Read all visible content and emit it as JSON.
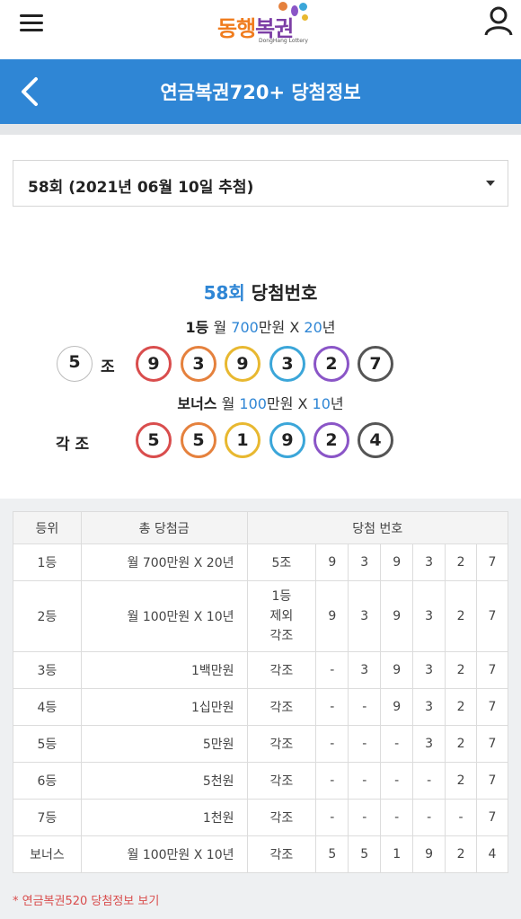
{
  "logo": {
    "text_a": "동행",
    "text_b": "복권",
    "sub": "DongHang Lottery"
  },
  "header": {
    "title": "연금복권720+ 당첨정보"
  },
  "select": {
    "value": "58회 (2021년 06월 10일 추첨)"
  },
  "result": {
    "round": "58회",
    "title_suffix": " 당첨번호",
    "first_label": "1등",
    "first_text_a": " 월 ",
    "first_amount": "700",
    "first_text_b": "만원 X ",
    "first_years": "20",
    "first_text_c": "년",
    "group": "5",
    "group_label": "조",
    "first_numbers": [
      "9",
      "3",
      "9",
      "3",
      "2",
      "7"
    ],
    "bonus_label": "보너스",
    "bonus_text_a": " 월 ",
    "bonus_amount": "100",
    "bonus_text_b": "만원 X ",
    "bonus_years": "10",
    "bonus_text_c": "년",
    "bonus_group_label": "각 조",
    "bonus_numbers": [
      "5",
      "5",
      "1",
      "9",
      "2",
      "4"
    ]
  },
  "table": {
    "headers": [
      "등위",
      "총 당첨금",
      "당첨 번호"
    ],
    "rows": [
      {
        "rank": "1등",
        "prize": "월 700만원 X 20년",
        "group": "5조",
        "nums": [
          "9",
          "3",
          "9",
          "3",
          "2",
          "7"
        ]
      },
      {
        "rank": "2등",
        "prize": "월 100만원 X 10년",
        "group": "1등\n제외\n각조",
        "nums": [
          "9",
          "3",
          "9",
          "3",
          "2",
          "7"
        ]
      },
      {
        "rank": "3등",
        "prize": "1백만원",
        "group": "각조",
        "nums": [
          "-",
          "3",
          "9",
          "3",
          "2",
          "7"
        ]
      },
      {
        "rank": "4등",
        "prize": "1십만원",
        "group": "각조",
        "nums": [
          "-",
          "-",
          "9",
          "3",
          "2",
          "7"
        ]
      },
      {
        "rank": "5등",
        "prize": "5만원",
        "group": "각조",
        "nums": [
          "-",
          "-",
          "-",
          "3",
          "2",
          "7"
        ]
      },
      {
        "rank": "6등",
        "prize": "5천원",
        "group": "각조",
        "nums": [
          "-",
          "-",
          "-",
          "-",
          "2",
          "7"
        ]
      },
      {
        "rank": "7등",
        "prize": "1천원",
        "group": "각조",
        "nums": [
          "-",
          "-",
          "-",
          "-",
          "-",
          "7"
        ]
      },
      {
        "rank": "보너스",
        "prize": "월 100만원 X 10년",
        "group": "각조",
        "nums": [
          "5",
          "5",
          "1",
          "9",
          "2",
          "4"
        ]
      }
    ]
  },
  "link": {
    "label": "* 연금복권520 당첨정보 보기"
  },
  "colors": {
    "brand_blue": "#2f86d5",
    "link_red": "#d94d4d"
  }
}
